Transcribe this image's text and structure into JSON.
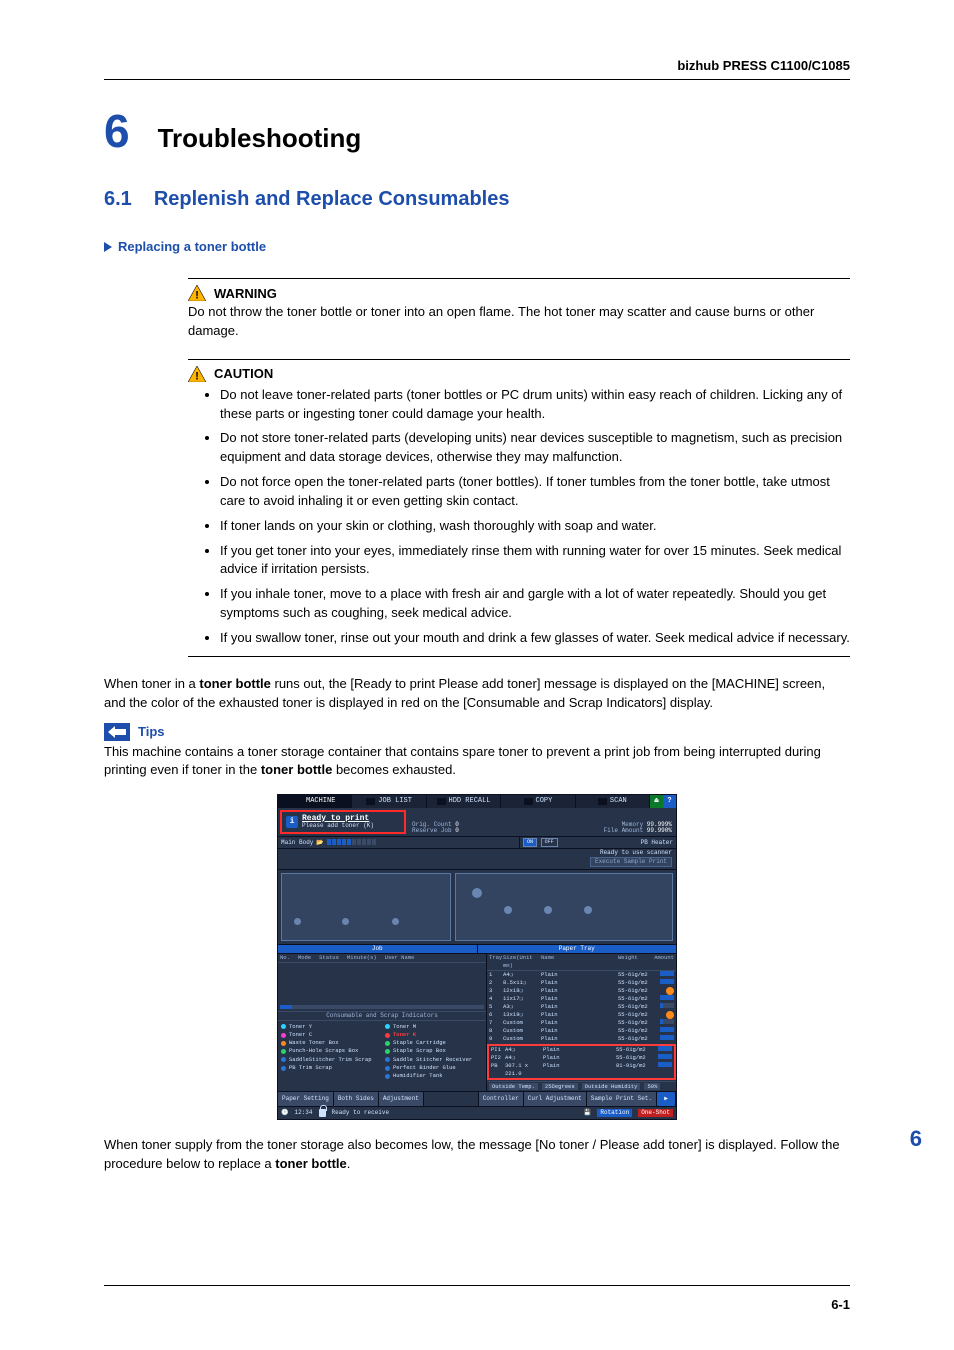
{
  "doc": {
    "model": "bizhub PRESS C1100/C1085",
    "chapter_num": "6",
    "chapter_title": "Troubleshooting",
    "section_num": "6.1",
    "section_title": "Replenish and Replace Consumables",
    "subhead": "Replacing a toner bottle",
    "page_num": "6-1",
    "side_num": "6"
  },
  "warning": {
    "title": "WARNING",
    "body": "Do not throw the toner bottle or toner into an open flame. The hot toner may scatter and cause burns or other damage."
  },
  "caution": {
    "title": "CAUTION",
    "items": [
      "Do not leave toner-related parts (toner bottles or PC drum units) within easy reach of children. Licking any of these parts or ingesting toner could damage your health.",
      "Do not store toner-related parts (developing units) near devices susceptible to magnetism, such as precision equipment and data storage devices, otherwise they may malfunction.",
      "Do not force open the toner-related parts (toner bottles). If toner tumbles from the toner bottle, take utmost care to avoid inhaling it or even getting skin contact.",
      "If toner lands on your skin or clothing, wash thoroughly with soap and water.",
      "If you get toner into your eyes, immediately rinse them with running water for over 15 minutes. Seek medical advice if irritation persists.",
      "If you inhale toner, move to a place with fresh air and gargle with a lot of water repeatedly. Should you get symptoms such as coughing, seek medical advice.",
      "If you swallow toner, rinse out your mouth and drink a few glasses of water. Seek medical advice if necessary."
    ]
  },
  "para1_a": "When toner in a ",
  "para1_b": "toner bottle",
  "para1_c": " runs out, the [Ready to print Please add toner] message is displayed on the [MACHINE] screen, and the color of the exhausted toner is displayed in red on the [Consumable and Scrap Indicators] display.",
  "tips": {
    "label": "Tips",
    "body_a": "This machine contains a toner storage container that contains spare toner to prevent a print job from being interrupted during printing even if toner in the ",
    "body_b": "toner bottle",
    "body_c": " becomes exhausted."
  },
  "para2_a": "When toner supply from the toner storage also becomes low, the message [No toner / Please add toner] is displayed. Follow the procedure below to replace a ",
  "para2_b": "toner bottle",
  "para2_c": ".",
  "panel": {
    "tabs": [
      "MACHINE",
      "JOB LIST",
      "HDD RECALL",
      "COPY",
      "SCAN"
    ],
    "msg_line1": "Ready to print",
    "msg_line2": "Please add toner (K)",
    "stats": {
      "orig_count_label": "Orig. Count",
      "orig_count_val": "0",
      "reserve_label": "Reserve Job",
      "reserve_val": "0",
      "memory_label": "Memory",
      "memory_val": "99.999%",
      "file_label": "File Amount",
      "file_val": "99.990%"
    },
    "main_body_label": "Main Body",
    "heater": {
      "label": "PB Heater",
      "on": "ON",
      "off": "OFF"
    },
    "scanner_msg": "Ready to use scanner",
    "sample_btn": "Execute Sample Print",
    "split": {
      "job": "Job",
      "tray": "Paper Tray"
    },
    "job_hdr": [
      "No.",
      "Mode",
      "Status",
      "Minute(s)",
      "User Name"
    ],
    "cons_title": "Consumable and Scrap Indicators",
    "cons_left": [
      {
        "icon": "cy",
        "text": "Toner Y"
      },
      {
        "icon": "mg",
        "text": "Toner C"
      },
      {
        "icon": "or",
        "text": "Waste Toner Box"
      },
      {
        "icon": "gr",
        "text": "Punch-Hole Scraps Box"
      },
      {
        "icon": "bl",
        "text": "SaddleStitcher Trim Scrap"
      },
      {
        "icon": "bl",
        "text": "PB Trim Scrap"
      }
    ],
    "cons_right": [
      {
        "icon": "cy",
        "text": "Toner M"
      },
      {
        "icon": "rd",
        "text": "Toner K",
        "red": true
      },
      {
        "icon": "gr",
        "text": "Staple Cartridge"
      },
      {
        "icon": "gr",
        "text": "Staple Scrap Box"
      },
      {
        "icon": "bl",
        "text": "Saddle Stitcher Receiver"
      },
      {
        "icon": "bl",
        "text": "Perfect Binder Glue"
      },
      {
        "icon": "bl",
        "text": "Humidifier Tank"
      }
    ],
    "tray_hdr": {
      "tray": "Tray",
      "size": "Size(Unit mm)",
      "name": "Name",
      "weight": "Weight",
      "amount": "Amount"
    },
    "trays": [
      {
        "n": "1",
        "size": "A4❏",
        "name": "Plain",
        "wt": "55-61g/m2",
        "am": "bar"
      },
      {
        "n": "2",
        "size": "8.5x11❏",
        "name": "Plain",
        "wt": "55-61g/m2",
        "am": "bar"
      },
      {
        "n": "3",
        "size": "12x18❏",
        "name": "Plain",
        "wt": "55-61g/m2",
        "am": "warn"
      },
      {
        "n": "4",
        "size": "11x17❏",
        "name": "Plain",
        "wt": "55-61g/m2",
        "am": "bar"
      },
      {
        "n": "5",
        "size": "A3❏",
        "name": "Plain",
        "wt": "55-61g/m2",
        "am": "low"
      },
      {
        "n": "6",
        "size": "13x19❏",
        "name": "Plain",
        "wt": "55-61g/m2",
        "am": "warn"
      },
      {
        "n": "7",
        "size": "Custom",
        "name": "Plain",
        "wt": "55-61g/m2",
        "am": "low"
      },
      {
        "n": "8",
        "size": "Custom",
        "name": "Plain",
        "wt": "55-61g/m2",
        "am": "bar"
      },
      {
        "n": "9",
        "size": "Custom",
        "name": "Plain",
        "wt": "55-61g/m2",
        "am": "bar"
      }
    ],
    "tray_pi": [
      {
        "n": "PI1",
        "size": "A4❏",
        "name": "Plain",
        "wt": "55-61g/m2",
        "am": "bar"
      },
      {
        "n": "PI2",
        "size": "A4❏",
        "name": "Plain",
        "wt": "55-61g/m2",
        "am": "bar"
      },
      {
        "n": "PB",
        "size": "307.1 x 221.0",
        "name": "Plain",
        "wt": "81-91g/m2",
        "am": "bar"
      }
    ],
    "env": {
      "ot_label": "Outside Temp.",
      "ot_val": "25Degrees",
      "oh_label": "Outside Humidity",
      "oh_val": "50%"
    },
    "footbtns": {
      "paper": "Paper Setting",
      "both": "Both Sides",
      "adj": "Adjustment",
      "ctrl": "Controller",
      "curl": "Curl Adjustment",
      "sample": "Sample Print Set."
    },
    "footer": {
      "time": "12:34",
      "status": "Ready to receive",
      "rot": "Rotation",
      "one": "One-Shot"
    }
  }
}
